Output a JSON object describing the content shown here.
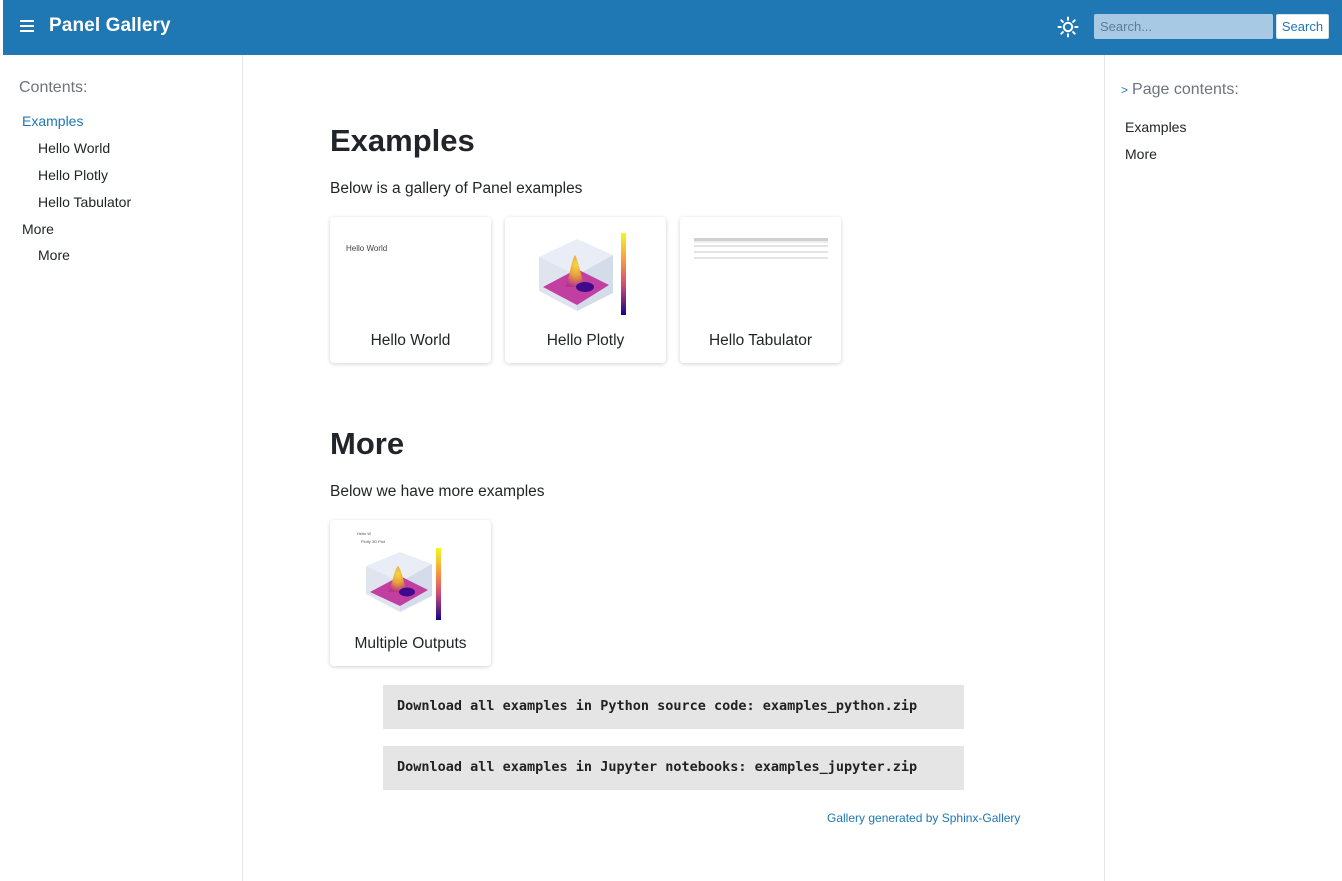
{
  "header": {
    "title": "Panel Gallery",
    "menu_icon": "hamburger-menu-icon",
    "theme_icon": "sun-icon",
    "search_placeholder": "Search...",
    "search_button": "Search",
    "bar_color": "#1f77b4"
  },
  "left_sidebar": {
    "heading": "Contents:",
    "items": [
      {
        "label": "Examples",
        "active": true
      },
      {
        "label": "Hello World"
      },
      {
        "label": "Hello Plotly"
      },
      {
        "label": "Hello Tabulator"
      },
      {
        "label": "More"
      },
      {
        "label": "More"
      }
    ]
  },
  "right_sidebar": {
    "heading": "Page contents:",
    "heading_icon": "chevron-right-icon",
    "items": [
      "Examples",
      "More"
    ]
  },
  "main": {
    "sections": [
      {
        "title": "Examples",
        "intro": "Below is a gallery of Panel examples",
        "cards": [
          {
            "caption": "Hello World",
            "thumb_text": "Hello World"
          },
          {
            "caption": "Hello Plotly"
          },
          {
            "caption": "Hello Tabulator"
          }
        ]
      },
      {
        "title": "More",
        "intro": "Below we have more examples",
        "cards": [
          {
            "caption": "Multiple Outputs",
            "thumb_text": [
              "Hello W",
              "Plotly 3D Plot"
            ]
          }
        ]
      }
    ],
    "downloads": [
      "Download all examples in Python source code: examples_python.zip",
      "Download all examples in Jupyter notebooks: examples_jupyter.zip"
    ],
    "credit": "Gallery generated by Sphinx-Gallery"
  },
  "colors": {
    "accent": "#1f77b4",
    "download_bg": "#e5e5e5"
  }
}
